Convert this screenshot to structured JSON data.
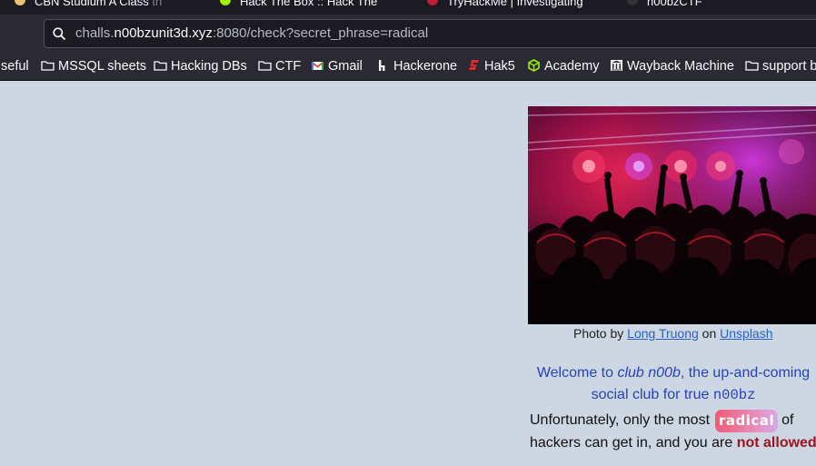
{
  "tabs": [
    {
      "label": "CBN Studium A Class",
      "fade": "  th"
    },
    {
      "label": "Hack The Box :: Hack The",
      "fade": ""
    },
    {
      "label": "TryHackMe | Investigating",
      "fade": ""
    },
    {
      "label": "n00bzCTF",
      "fade": ""
    }
  ],
  "urlbar": {
    "prefix": "challs.",
    "host": "n00bzunit3d.xyz",
    "rest": ":8080/check?secret_phrase=radical"
  },
  "bookmarks": [
    {
      "label": "seful",
      "icon": "none"
    },
    {
      "label": "MSSQL sheets",
      "icon": "folder-icon"
    },
    {
      "label": "Hacking DBs",
      "icon": "folder-icon"
    },
    {
      "label": "CTF",
      "icon": "folder-icon"
    },
    {
      "label": "Gmail",
      "icon": "gmail-icon"
    },
    {
      "label": "Hackerone",
      "icon": "hackerone-icon"
    },
    {
      "label": "Hak5",
      "icon": "hak5-icon"
    },
    {
      "label": "Academy",
      "icon": "htb-academy-icon"
    },
    {
      "label": "Wayback Machine",
      "icon": "wayback-icon"
    },
    {
      "label": "support b",
      "icon": "folder-icon"
    }
  ],
  "page": {
    "caption_prefix": "Photo by ",
    "caption_author": "Long Truong",
    "caption_mid": " on ",
    "caption_site": "Unsplash",
    "welcome_1": "Welcome to ",
    "welcome_club": "club n00b",
    "welcome_2": ", the up-and-coming social club for true ",
    "welcome_code": "n00bz",
    "unfortunately_1": "Unfortunately, only the most",
    "radical": "radical",
    "unfortunately_2": "of hackers can get in, and you are ",
    "not_allowed": "not allowed"
  },
  "colors": {
    "chrome_bg": "#2b2a33",
    "page_bg": "#cdd6e3",
    "link": "#2a63c8",
    "welcome_text": "#2742b8",
    "not_allowed": "#9b1420"
  }
}
